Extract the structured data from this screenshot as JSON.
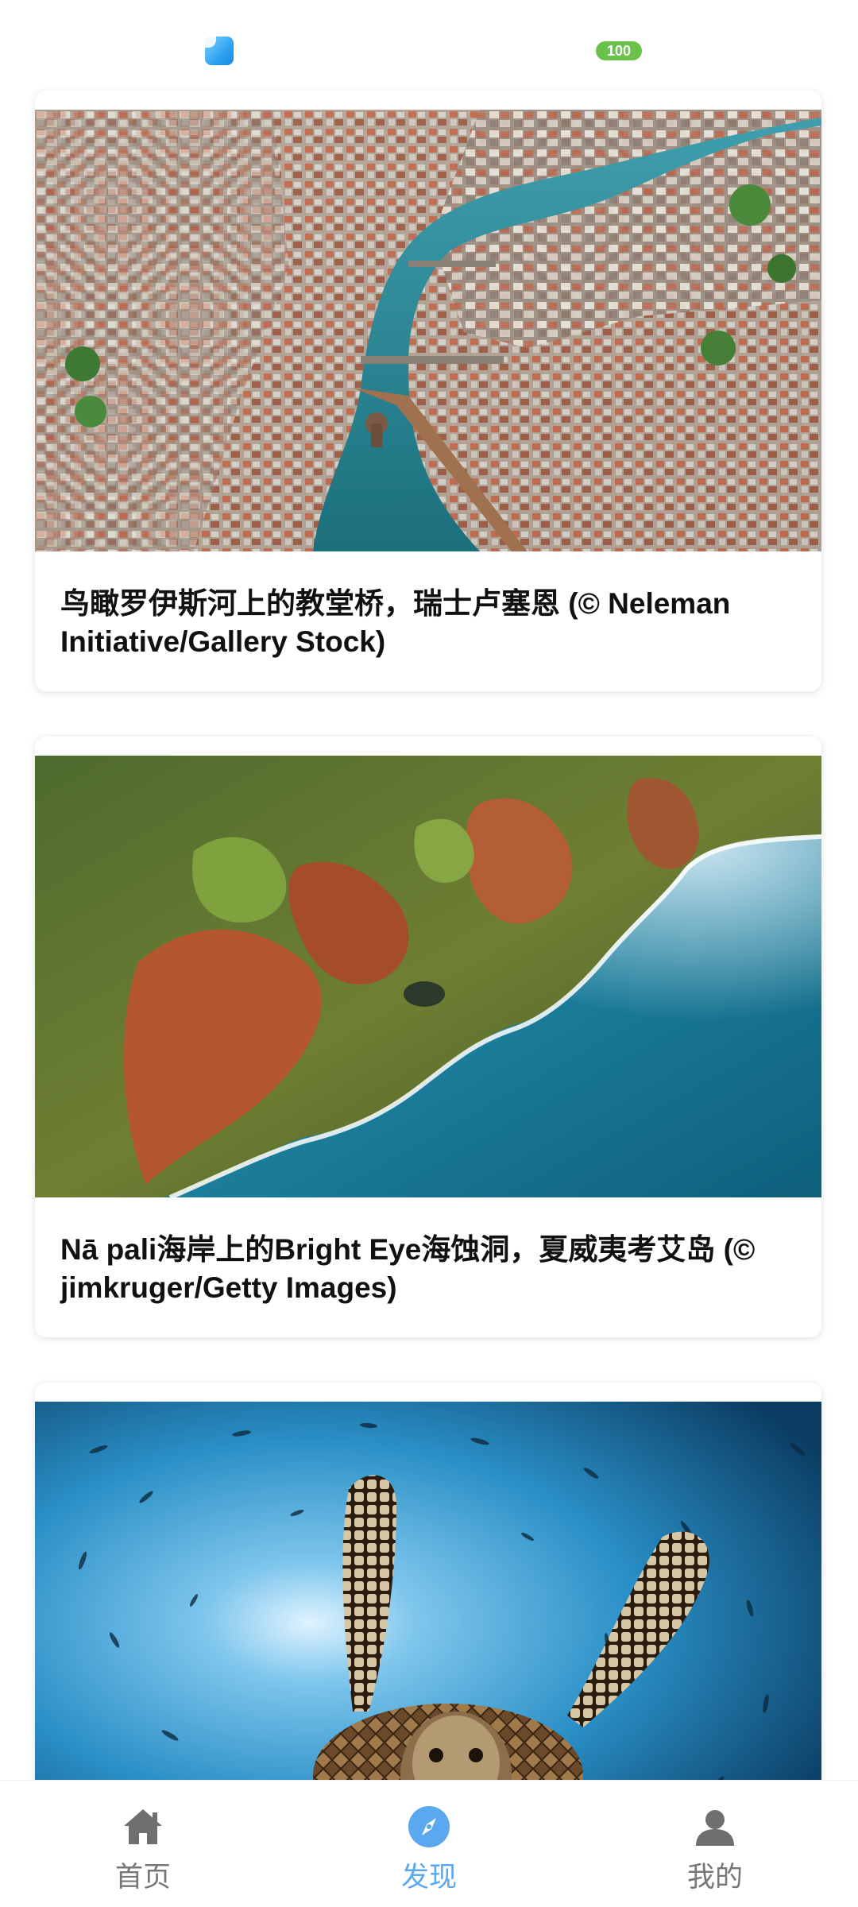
{
  "status_bar": {
    "battery_level": "100",
    "colors": {
      "battery": "#6ac24a",
      "app_icon": "#2fa3f2"
    },
    "icons": [
      "app-icon",
      "battery-icon"
    ]
  },
  "feed": {
    "cards": [
      {
        "image": "aerial-lucerne-chapel-bridge",
        "caption": "鸟瞰罗伊斯河上的教堂桥，瑞士卢塞恩 (© Neleman Initiative/Gallery Stock)"
      },
      {
        "image": "na-pali-coast-sea-cave",
        "caption": "Nā pali海岸上的Bright Eye海蚀洞，夏威夷考艾岛 (© jimkruger/Getty Images)"
      },
      {
        "image": "sea-turtle-fish-school",
        "caption": ""
      }
    ]
  },
  "bottom_nav": {
    "items": [
      {
        "label": "首页",
        "icon": "home-icon",
        "active": false
      },
      {
        "label": "发现",
        "icon": "compass-icon",
        "active": true
      },
      {
        "label": "我的",
        "icon": "user-icon",
        "active": false
      }
    ],
    "colors": {
      "active": "#5aa8f0",
      "inactive": "#777777"
    }
  }
}
